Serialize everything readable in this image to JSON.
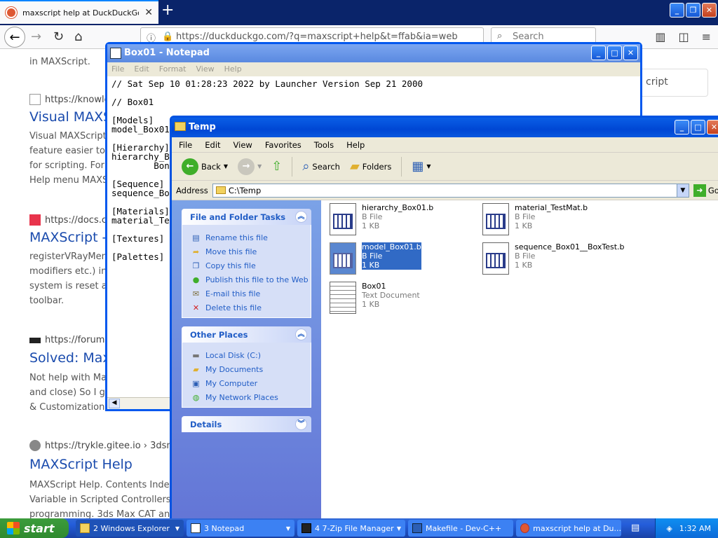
{
  "firefox": {
    "tab_title": "maxscript help at DuckDuckGo",
    "url": "https://duckduckgo.com/?q=maxscript+help&t=ffab&ia=web",
    "search_placeholder": "Search",
    "results": [
      {
        "snippet_top": "in MAXScript."
      },
      {
        "url": "https://knowle",
        "title": "Visual MAXS",
        "snippet": [
          "Visual MAXScript",
          "feature easier to",
          "for scripting. For",
          "Help menu MAXS"
        ]
      },
      {
        "url": "https://docs.c",
        "title": "MAXScript -",
        "snippet": [
          "registerVRayMen",
          "modifiers etc.) into",
          "system is reset an",
          "toolbar."
        ]
      },
      {
        "url": "https://forums",
        "title": "Solved: Max",
        "snippet": [
          "Not help with Max",
          "and close) So I go",
          "& Customization'"
        ]
      },
      {
        "url": "https://trykle.gitee.io › 3dsm",
        "title": "MAXScript Help",
        "snippet": [
          "MAXScript Help. Contents Index",
          "Variable in Scripted Controllers V",
          "programming. 3ds Max CAT and"
        ]
      }
    ],
    "side_card": "cript"
  },
  "notepad": {
    "title": "Box01 - Notepad",
    "menu": [
      "File",
      "Edit",
      "Format",
      "View",
      "Help"
    ],
    "lines": [
      "// Sat Sep 10 01:28:23 2022 by Launcher Version Sep 21 2000",
      "",
      "// Box01",
      "",
      "[Models]",
      "model_Box01",
      "",
      "[Hierarchy]",
      "hierarchy_B",
      "        Bon",
      "",
      "[Sequence]",
      "sequence_Bo",
      "",
      "[Materials]",
      "material_Te",
      "",
      "[Textures]",
      "",
      "[Palettes]"
    ]
  },
  "explorer": {
    "title": "Temp",
    "menu": [
      "File",
      "Edit",
      "View",
      "Favorites",
      "Tools",
      "Help"
    ],
    "toolbar": {
      "back": "Back",
      "search": "Search",
      "folders": "Folders"
    },
    "address_label": "Address",
    "address": "C:\\Temp",
    "go": "Go",
    "tasks_header": "File and Folder Tasks",
    "tasks": [
      "Rename this file",
      "Move this file",
      "Copy this file",
      "Publish this file to the Web",
      "E-mail this file",
      "Delete this file"
    ],
    "places_header": "Other Places",
    "places": [
      "Local Disk (C:)",
      "My Documents",
      "My Computer",
      "My Network Places"
    ],
    "details_header": "Details",
    "files": [
      {
        "name": "hierarchy_Box01.b",
        "type": "B File",
        "size": "1 KB",
        "selected": false
      },
      {
        "name": "material_TestMat.b",
        "type": "B File",
        "size": "1 KB",
        "selected": false
      },
      {
        "name": "model_Box01.b",
        "type": "B File",
        "size": "1 KB",
        "selected": true
      },
      {
        "name": "sequence_Box01__BoxTest.b",
        "type": "B File",
        "size": "1 KB",
        "selected": false
      },
      {
        "name": "Box01",
        "type": "Text Document",
        "size": "1 KB",
        "selected": false
      }
    ]
  },
  "taskbar": {
    "start": "start",
    "items": [
      {
        "label": "2 Windows Explorer",
        "active": true
      },
      {
        "label": "3 Notepad",
        "active": false
      },
      {
        "label": "4 7-Zip File Manager",
        "active": false
      },
      {
        "label": "Makefile - Dev-C++",
        "active": false
      },
      {
        "label": "maxscript help at Du...",
        "active": false
      }
    ],
    "clock": "1:32 AM"
  }
}
